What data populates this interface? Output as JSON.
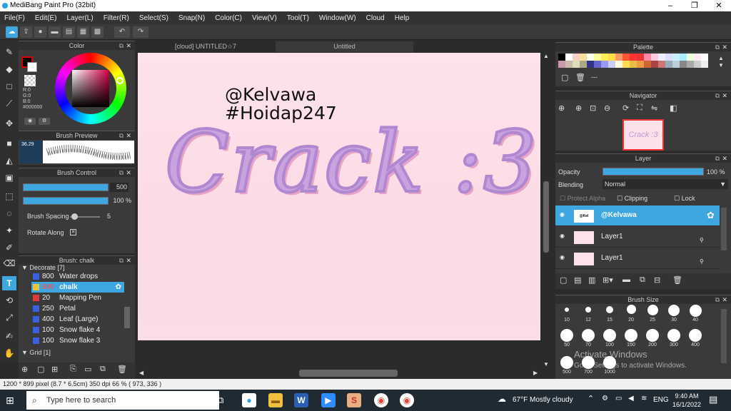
{
  "window": {
    "title": "MediBang Paint Pro (32bit)",
    "controls": [
      "–",
      "❐",
      "✕"
    ]
  },
  "menu": [
    "File(F)",
    "Edit(E)",
    "Layer(L)",
    "Filter(R)",
    "Select(S)",
    "Snap(N)",
    "Color(C)",
    "View(V)",
    "Tool(T)",
    "Window(W)",
    "Cloud",
    "Help"
  ],
  "panels": {
    "color": {
      "title": "Color",
      "r": "R:0",
      "g": "G:0",
      "b": "B:0",
      "hex": "#000000"
    },
    "brush_preview": {
      "title": "Brush Preview",
      "size": "36.29"
    },
    "brush_control": {
      "title": "Brush Control",
      "size_value": "500",
      "opacity_value": "100 %",
      "spacing_label": "Brush Spacing",
      "spacing_value": "5",
      "rotate_label": "Rotate Along"
    },
    "brush_list": {
      "title": "Brush: chalk",
      "group1": "Decorate [7]",
      "items": [
        {
          "num": "800",
          "label": "Water drops",
          "color": "#3a5fe0"
        },
        {
          "num": "500",
          "label": "chalk",
          "color": "#e8c43a"
        },
        {
          "num": "20",
          "label": "Mapping Pen",
          "color": "#e03a3a"
        },
        {
          "num": "250",
          "label": "Petal",
          "color": "#3a5fe0"
        },
        {
          "num": "400",
          "label": "Leaf (Large)",
          "color": "#3a5fe0"
        },
        {
          "num": "100",
          "label": "Snow flake 4",
          "color": "#3a5fe0"
        },
        {
          "num": "100",
          "label": "Snow flake 3",
          "color": "#3a5fe0"
        }
      ],
      "group2": "Grid [1]"
    },
    "palette": {
      "title": "Palette",
      "sep": "---"
    },
    "navigator": {
      "title": "Navigator"
    },
    "layer": {
      "title": "Layer",
      "opacity_label": "Opacity",
      "opacity_value": "100 %",
      "blending_label": "Blending",
      "blending_value": "Normal",
      "protect_alpha": "Protect Alpha",
      "clipping": "Clipping",
      "lock": "Lock",
      "layers": [
        {
          "name": "@Kelvawa"
        },
        {
          "name": "Layer1"
        },
        {
          "name": "Layer1"
        }
      ]
    },
    "brush_size": {
      "title": "Brush Size",
      "sizes": [
        "10",
        "12",
        "15",
        "20",
        "25",
        "30",
        "40",
        "50",
        "70",
        "100",
        "150",
        "200",
        "300",
        "400",
        "500",
        "700",
        "1000"
      ]
    }
  },
  "tabs": [
    "[cloud] UNTITLED☆7",
    "Untitled"
  ],
  "canvas_text": {
    "line1": "@Kelvawa",
    "line2": "#Hoidap247",
    "art": "Crack :3"
  },
  "status": "1200 * 899 pixel  (8.7 * 6.5cm)  350 dpi  66 %  ( 973, 336 )",
  "taskbar": {
    "search": "Type here to search",
    "weather": "67°F  Mostly cloudy",
    "lang": "ENG",
    "time": "9:40 AM",
    "date": "16/1/2022"
  },
  "watermark": {
    "line1": "Activate Windows",
    "line2": "Go to Settings to activate Windows."
  }
}
